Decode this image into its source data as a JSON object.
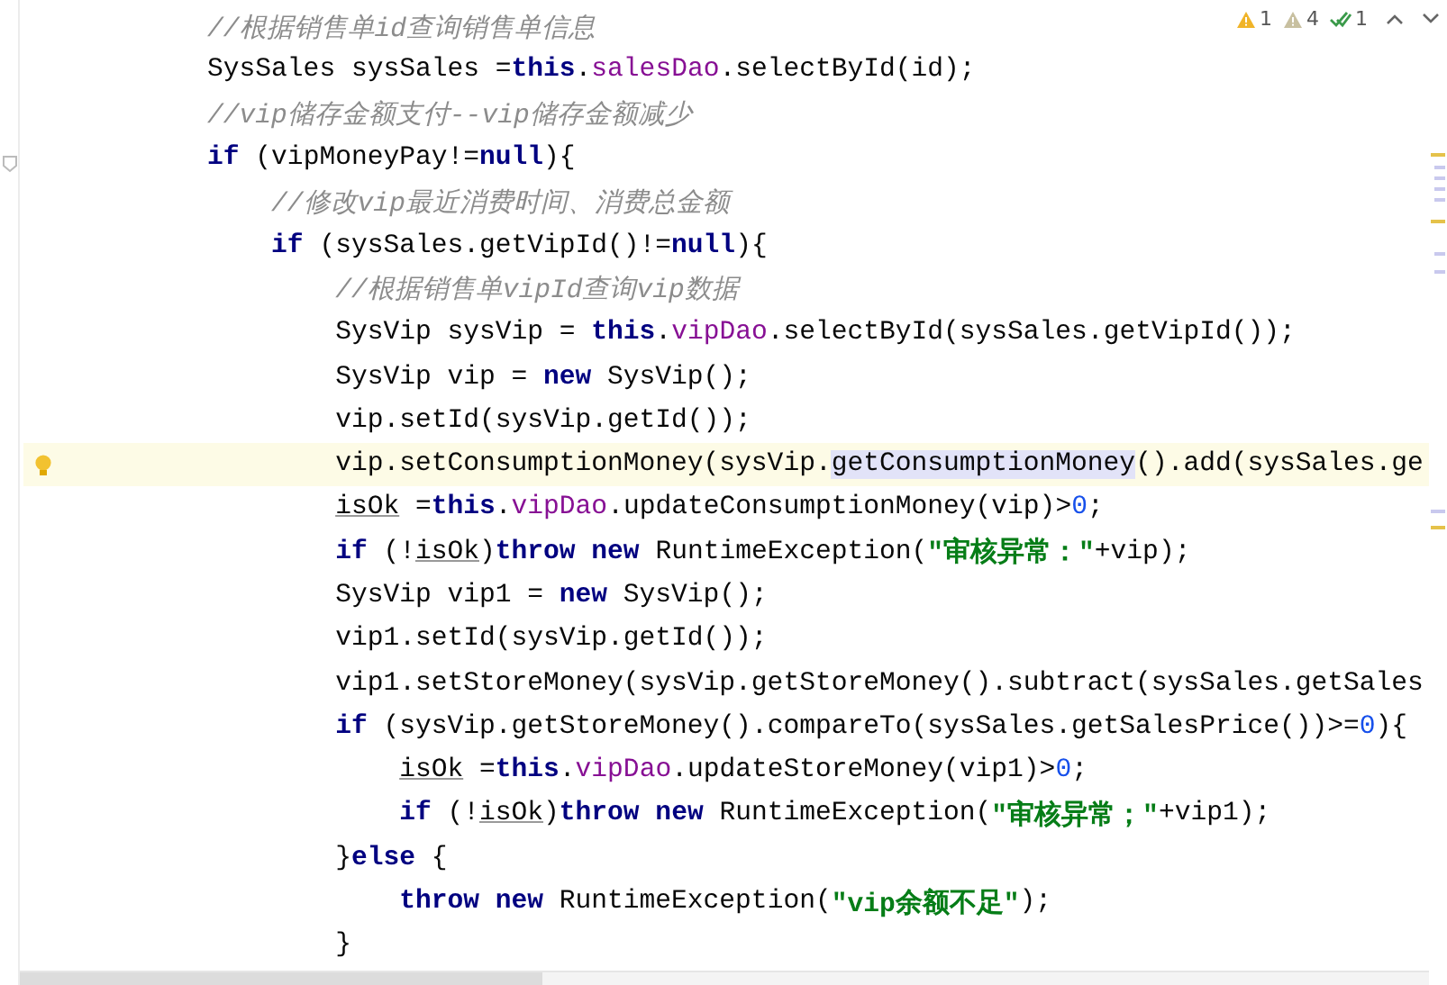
{
  "inspections": [
    {
      "kind": "warning",
      "count": "1"
    },
    {
      "kind": "weak",
      "count": "4"
    },
    {
      "kind": "ok",
      "count": "1"
    }
  ],
  "lines": [
    {
      "current": false,
      "tokens": [
        {
          "kind": "comment",
          "text": "//根据销售单id查询销售单信息"
        }
      ]
    },
    {
      "current": false,
      "tokens": [
        {
          "kind": "plain",
          "text": "SysSales sysSales ="
        },
        {
          "kind": "keyword",
          "text": "this"
        },
        {
          "kind": "plain",
          "text": "."
        },
        {
          "kind": "field",
          "text": "salesDao"
        },
        {
          "kind": "plain",
          "text": ".selectById(id);"
        }
      ]
    },
    {
      "current": false,
      "tokens": [
        {
          "kind": "comment",
          "text": "//vip储存金额支付--vip储存金额减少"
        }
      ]
    },
    {
      "current": false,
      "tokens": [
        {
          "kind": "keyword",
          "text": "if"
        },
        {
          "kind": "plain",
          "text": " (vipMoneyPay!="
        },
        {
          "kind": "keyword",
          "text": "null"
        },
        {
          "kind": "plain",
          "text": "){"
        }
      ],
      "children": [
        {
          "current": false,
          "tokens": [
            {
              "kind": "comment",
              "text": "//修改vip最近消费时间、消费总金额"
            }
          ]
        },
        {
          "current": false,
          "tokens": [
            {
              "kind": "keyword",
              "text": "if"
            },
            {
              "kind": "plain",
              "text": " (sysSales.getVipId()!="
            },
            {
              "kind": "keyword",
              "text": "null"
            },
            {
              "kind": "plain",
              "text": "){"
            }
          ],
          "children": [
            {
              "current": false,
              "tokens": [
                {
                  "kind": "comment",
                  "text": "//根据销售单vipId查询vip数据"
                }
              ]
            },
            {
              "current": false,
              "tokens": [
                {
                  "kind": "plain",
                  "text": "SysVip sysVip = "
                },
                {
                  "kind": "keyword",
                  "text": "this"
                },
                {
                  "kind": "plain",
                  "text": "."
                },
                {
                  "kind": "field",
                  "text": "vipDao"
                },
                {
                  "kind": "plain",
                  "text": ".selectById(sysSales.getVipId());"
                }
              ]
            },
            {
              "current": false,
              "tokens": [
                {
                  "kind": "plain",
                  "text": "SysVip vip = "
                },
                {
                  "kind": "keyword",
                  "text": "new"
                },
                {
                  "kind": "plain",
                  "text": " SysVip();"
                }
              ]
            },
            {
              "current": false,
              "tokens": [
                {
                  "kind": "plain",
                  "text": "vip.setId(sysVip.getId());"
                }
              ]
            },
            {
              "current": true,
              "tokens": [
                {
                  "kind": "plain",
                  "text": "vip.setConsumptionMoney(sysVip."
                },
                {
                  "kind": "usage",
                  "text": "getConsumptionMoney"
                },
                {
                  "kind": "plain",
                  "text": "().add(sysSales.ge"
                }
              ]
            },
            {
              "current": false,
              "tokens": [
                {
                  "kind": "underlined",
                  "text": "isOk"
                },
                {
                  "kind": "plain",
                  "text": " ="
                },
                {
                  "kind": "keyword",
                  "text": "this"
                },
                {
                  "kind": "plain",
                  "text": "."
                },
                {
                  "kind": "field",
                  "text": "vipDao"
                },
                {
                  "kind": "plain",
                  "text": ".updateConsumptionMoney(vip)>"
                },
                {
                  "kind": "number",
                  "text": "0"
                },
                {
                  "kind": "plain",
                  "text": ";"
                }
              ]
            },
            {
              "current": false,
              "tokens": [
                {
                  "kind": "keyword",
                  "text": "if"
                },
                {
                  "kind": "plain",
                  "text": " (!"
                },
                {
                  "kind": "underlined",
                  "text": "isOk"
                },
                {
                  "kind": "plain",
                  "text": ")"
                },
                {
                  "kind": "keyword",
                  "text": "throw new"
                },
                {
                  "kind": "plain",
                  "text": " RuntimeException("
                },
                {
                  "kind": "string",
                  "text": "\"审核异常：\""
                },
                {
                  "kind": "plain",
                  "text": "+vip);"
                }
              ]
            },
            {
              "current": false,
              "tokens": [
                {
                  "kind": "plain",
                  "text": "SysVip vip1 = "
                },
                {
                  "kind": "keyword",
                  "text": "new"
                },
                {
                  "kind": "plain",
                  "text": " SysVip();"
                }
              ]
            },
            {
              "current": false,
              "tokens": [
                {
                  "kind": "plain",
                  "text": "vip1.setId(sysVip.getId());"
                }
              ]
            },
            {
              "current": false,
              "tokens": [
                {
                  "kind": "plain",
                  "text": "vip1.setStoreMoney(sysVip.getStoreMoney().subtract(sysSales.getSales"
                }
              ]
            },
            {
              "current": false,
              "tokens": [
                {
                  "kind": "keyword",
                  "text": "if"
                },
                {
                  "kind": "plain",
                  "text": " (sysVip.getStoreMoney().compareTo(sysSales.getSalesPrice())>="
                },
                {
                  "kind": "number",
                  "text": "0"
                },
                {
                  "kind": "plain",
                  "text": "){"
                }
              ],
              "children": [
                {
                  "current": false,
                  "tokens": [
                    {
                      "kind": "underlined",
                      "text": "isOk"
                    },
                    {
                      "kind": "plain",
                      "text": " ="
                    },
                    {
                      "kind": "keyword",
                      "text": "this"
                    },
                    {
                      "kind": "plain",
                      "text": "."
                    },
                    {
                      "kind": "field",
                      "text": "vipDao"
                    },
                    {
                      "kind": "plain",
                      "text": ".updateStoreMoney(vip1)>"
                    },
                    {
                      "kind": "number",
                      "text": "0"
                    },
                    {
                      "kind": "plain",
                      "text": ";"
                    }
                  ]
                },
                {
                  "current": false,
                  "tokens": [
                    {
                      "kind": "keyword",
                      "text": "if"
                    },
                    {
                      "kind": "plain",
                      "text": " (!"
                    },
                    {
                      "kind": "underlined",
                      "text": "isOk"
                    },
                    {
                      "kind": "plain",
                      "text": ")"
                    },
                    {
                      "kind": "keyword",
                      "text": "throw new"
                    },
                    {
                      "kind": "plain",
                      "text": " RuntimeException("
                    },
                    {
                      "kind": "string",
                      "text": "\"审核异常；\""
                    },
                    {
                      "kind": "plain",
                      "text": "+vip1);"
                    }
                  ]
                }
              ]
            },
            {
              "current": false,
              "tokens": [
                {
                  "kind": "plain",
                  "text": "}"
                },
                {
                  "kind": "keyword",
                  "text": "else"
                },
                {
                  "kind": "plain",
                  "text": " {"
                }
              ],
              "children": [
                {
                  "current": false,
                  "tokens": [
                    {
                      "kind": "keyword",
                      "text": "throw new"
                    },
                    {
                      "kind": "plain",
                      "text": " RuntimeException("
                    },
                    {
                      "kind": "string",
                      "text": "\"vip余额不足\""
                    },
                    {
                      "kind": "plain",
                      "text": ");"
                    }
                  ]
                }
              ]
            },
            {
              "current": false,
              "tokens": [
                {
                  "kind": "plain",
                  "text": "}"
                }
              ]
            }
          ]
        }
      ]
    }
  ]
}
